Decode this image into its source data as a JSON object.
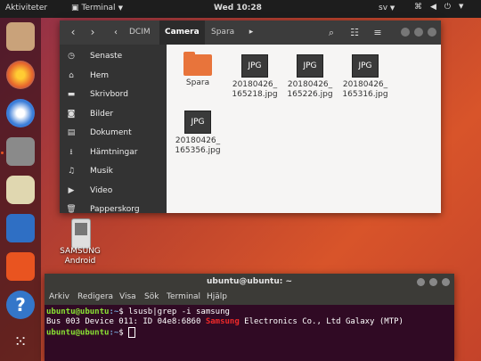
{
  "topbar": {
    "activities": "Aktiviteter",
    "app_name": "Terminal",
    "clock": "Wed 10:28",
    "language": "sv",
    "icons": [
      "network-icon",
      "volume-icon",
      "power-icon"
    ]
  },
  "dock": {
    "items": [
      "files-app-icon",
      "firefox-icon",
      "thunderbird-icon",
      "files-icon",
      "rhythmbox-icon",
      "libreoffice-writer-icon",
      "software-center-icon",
      "help-icon",
      "show-apps-icon"
    ]
  },
  "desktop": {
    "device_label_line1": "SAMSUNG",
    "device_label_line2": "Android"
  },
  "file_manager": {
    "breadcrumbs": [
      "DCIM",
      "Camera",
      "Spara"
    ],
    "active_crumb": "Camera",
    "sidebar": [
      {
        "icon": "clock-icon",
        "label": "Senaste"
      },
      {
        "icon": "home-icon",
        "label": "Hem"
      },
      {
        "icon": "folder-icon",
        "label": "Skrivbord"
      },
      {
        "icon": "camera-icon",
        "label": "Bilder"
      },
      {
        "icon": "document-icon",
        "label": "Dokument"
      },
      {
        "icon": "download-icon",
        "label": "Hämtningar"
      },
      {
        "icon": "music-icon",
        "label": "Musik"
      },
      {
        "icon": "video-icon",
        "label": "Video"
      },
      {
        "icon": "trash-icon",
        "label": "Papperskorg"
      }
    ],
    "files": [
      {
        "type": "folder",
        "name": "Spara"
      },
      {
        "type": "jpg",
        "badge": "JPG",
        "name": "20180426_ 165218.jpg"
      },
      {
        "type": "jpg",
        "badge": "JPG",
        "name": "20180426_ 165226.jpg"
      },
      {
        "type": "jpg",
        "badge": "JPG",
        "name": "20180426_ 165316.jpg"
      },
      {
        "type": "jpg",
        "badge": "JPG",
        "name": "20180426_ 165356.jpg"
      }
    ]
  },
  "terminal": {
    "title": "ubuntu@ubuntu: ~",
    "menu": [
      "Arkiv",
      "Redigera",
      "Visa",
      "Sök",
      "Terminal",
      "Hjälp"
    ],
    "line1_user": "ubuntu@ubuntu",
    "line1_path": ":~",
    "line1_cmd": "$ lsusb|grep -i samsung",
    "line2_pre": "Bus 003 Device 011: ID 04e8:6860 ",
    "line2_match": "Samsung",
    "line2_post": " Electronics Co., Ltd Galaxy (MTP)",
    "line3_user": "ubuntu@ubuntu",
    "line3_path": ":~",
    "line3_cmd": "$ "
  },
  "colors": {
    "accent": "#e95420",
    "terminal_bg": "#300a24",
    "prompt_green": "#8ae234",
    "path_blue": "#729fcf",
    "match_red": "#ef2929"
  }
}
